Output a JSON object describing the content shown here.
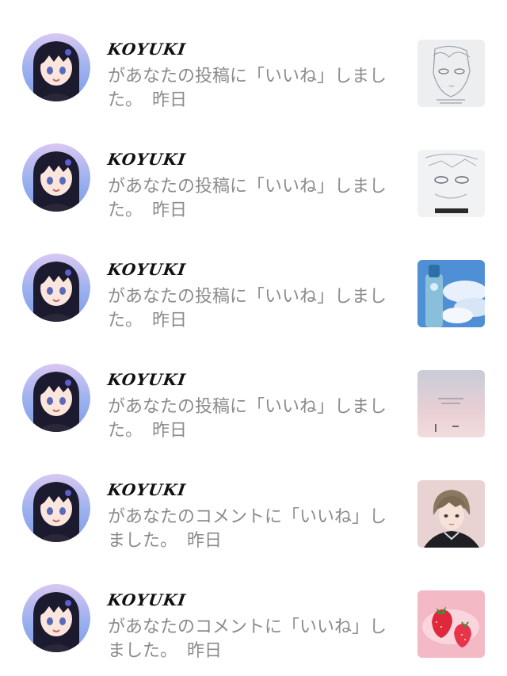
{
  "notifications": [
    {
      "username": "KOYUKI",
      "message": "があなたの投稿に「いいね」しました。",
      "time": "昨日",
      "thumbnail": "sketch-face-thumbnail"
    },
    {
      "username": "KOYUKI",
      "message": "があなたの投稿に「いいね」しました。",
      "time": "昨日",
      "thumbnail": "sketch-eyes-thumbnail"
    },
    {
      "username": "KOYUKI",
      "message": "があなたの投稿に「いいね」しました。",
      "time": "昨日",
      "thumbnail": "ramune-sky-thumbnail"
    },
    {
      "username": "KOYUKI",
      "message": "があなたの投稿に「いいね」しました。",
      "time": "昨日",
      "thumbnail": "pink-sky-thumbnail"
    },
    {
      "username": "KOYUKI",
      "message": "があなたのコメントに「いいね」しました。",
      "time": "昨日",
      "thumbnail": "character-portrait-thumbnail"
    },
    {
      "username": "KOYUKI",
      "message": "があなたのコメントに「いいね」しました。",
      "time": "昨日",
      "thumbnail": "strawberry-thumbnail"
    }
  ]
}
